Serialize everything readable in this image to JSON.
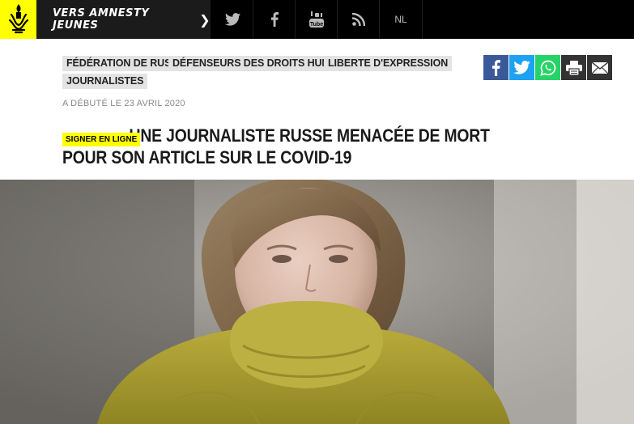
{
  "header": {
    "jeunes_label": "VERS AMNESTY JEUNES",
    "lang_label": "NL",
    "icons": [
      "candle-logo-icon",
      "twitter-icon",
      "facebook-icon",
      "youtube-icon",
      "rss-icon"
    ]
  },
  "tags": [
    "FÉDÉRATION DE RUSSIE",
    "DÉFENSEURS DES DROITS HUMAINS",
    "LIBERTE D'EXPRESSION",
    "JOURNALISTES"
  ],
  "share": {
    "icons": [
      "facebook-icon",
      "twitter-icon",
      "whatsapp-icon",
      "print-icon",
      "mail-icon"
    ],
    "colors": {
      "facebook": "#3b5998",
      "twitter": "#1da1f2",
      "whatsapp": "#25d366",
      "print": "#333333",
      "mail": "#333333"
    }
  },
  "article": {
    "date": "A DÉBUTÉ LE 23 AVRIL 2020",
    "badge": "SIGNER EN LIGNE",
    "title": "UNE JOURNALISTE RUSSE MENACÉE DE MORT POUR SON ARTICLE SUR LE COVID-19"
  },
  "colors": {
    "brand_yellow": "#ffff00",
    "topbar": "#000000",
    "tag_bg": "#e3e3e3"
  }
}
